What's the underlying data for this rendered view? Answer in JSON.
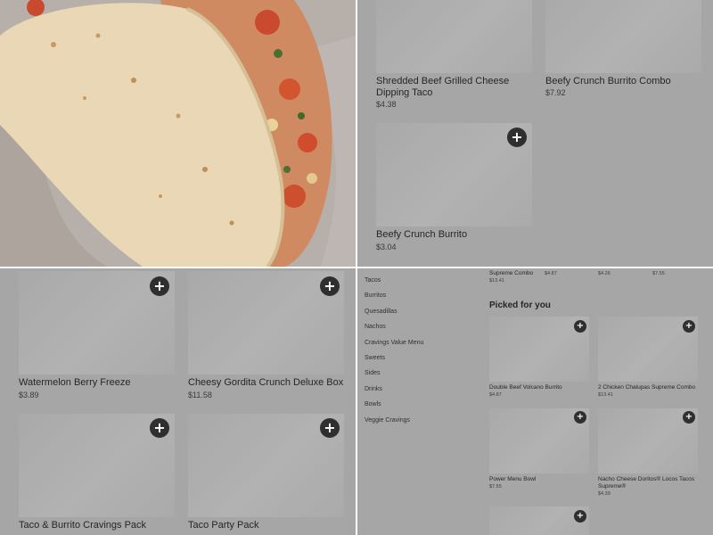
{
  "top_right": {
    "items": [
      {
        "name": "Shredded Beef Grilled Cheese Dipping Taco",
        "price": "$4.38"
      },
      {
        "name": "Beefy Crunch Burrito Combo",
        "price": "$7.92"
      },
      {
        "name": "Beefy Crunch Burrito",
        "price": "$3.04"
      }
    ],
    "add_label": "+"
  },
  "bottom_left": {
    "items": [
      {
        "name": "Watermelon Berry Freeze",
        "price": "$3.89"
      },
      {
        "name": "Cheesy Gordita Crunch Deluxe Box",
        "price": "$11.58"
      },
      {
        "name": "Taco & Burrito Cravings Pack",
        "price": ""
      },
      {
        "name": "Taco Party Pack",
        "price": ""
      }
    ],
    "add_label": "+"
  },
  "bottom_right": {
    "sidebar": [
      "Tacos",
      "Burritos",
      "Quesadillas",
      "Nachos",
      "Cravings Value Menu",
      "Sweets",
      "Sides",
      "Drinks",
      "Bowls",
      "Veggie Cravings"
    ],
    "top_row": [
      {
        "name": "Supreme Combo",
        "price": "$13.41"
      },
      {
        "name": "",
        "price": "$4.87"
      },
      {
        "name": "",
        "price": "$4.26"
      },
      {
        "name": "",
        "price": "$7.55"
      }
    ],
    "section_title": "Picked for you",
    "picked": [
      {
        "name": "Double Beef Volcano Burrito",
        "price": "$4.87"
      },
      {
        "name": "2 Chicken Chalupas Supreme Combo",
        "price": "$13.41"
      },
      {
        "name": "Power Menu Bowl",
        "price": "$7.55"
      },
      {
        "name": "Nacho Cheese Doritos® Locos Tacos Supreme®",
        "price": "$4.39"
      }
    ],
    "add_label": "+"
  },
  "colors": {
    "overlay_gray": "#a6a6a6",
    "button_dark": "#2f2f2f"
  }
}
